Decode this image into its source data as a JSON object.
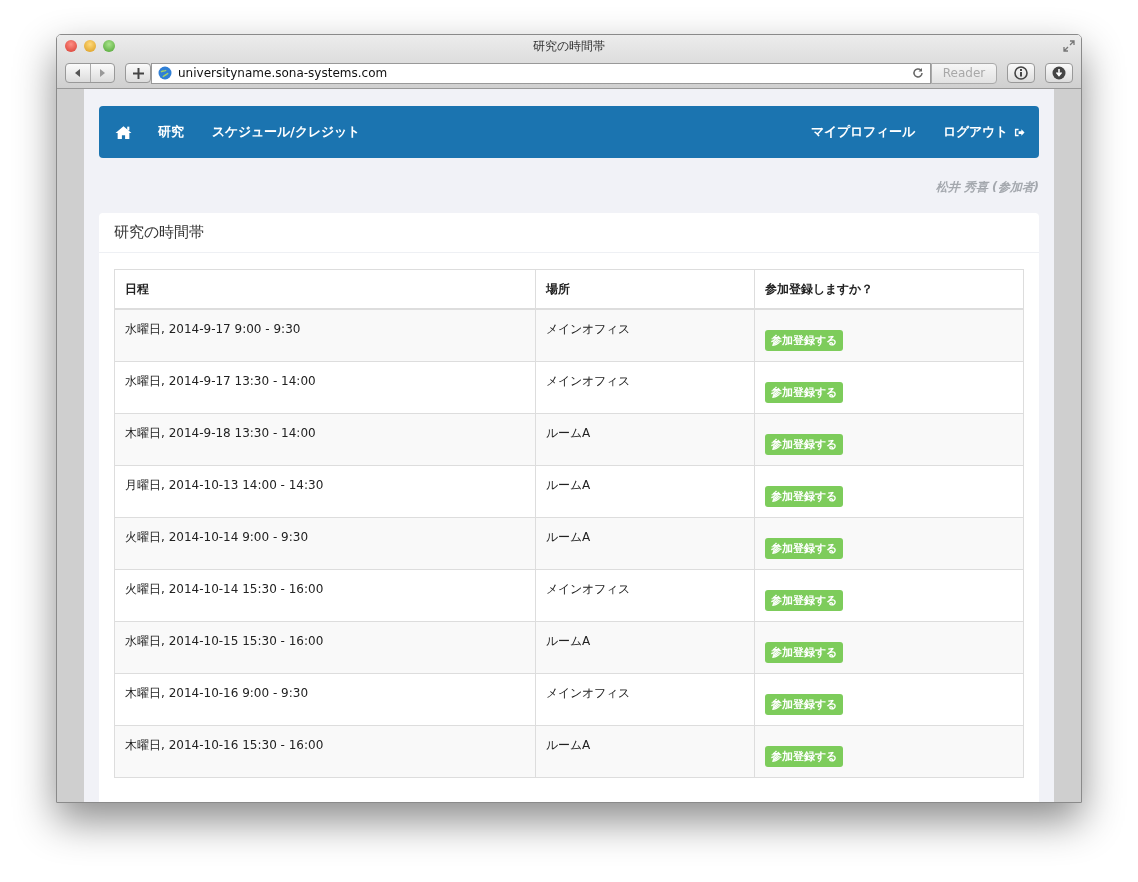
{
  "window": {
    "title": "研究の時間帯",
    "url": "universityname.sona-systems.com",
    "reader_button": "Reader"
  },
  "nav": {
    "items": [
      "研究",
      "スケジュール/クレジット"
    ],
    "right_items": [
      "マイプロフィール",
      "ログアウト"
    ]
  },
  "user": "松井 秀喜 (参加者)",
  "panel": {
    "title": "研究の時間帯"
  },
  "table": {
    "columns": [
      "日程",
      "場所",
      "参加登録しますか？"
    ],
    "rows": [
      {
        "date": "水曜日, 2014-9-17 9:00 - 9:30",
        "location": "メインオフィス",
        "action": "参加登録する"
      },
      {
        "date": "水曜日, 2014-9-17 13:30 - 14:00",
        "location": "メインオフィス",
        "action": "参加登録する"
      },
      {
        "date": "木曜日, 2014-9-18 13:30 - 14:00",
        "location": "ルームA",
        "action": "参加登録する"
      },
      {
        "date": "月曜日, 2014-10-13 14:00 - 14:30",
        "location": "ルームA",
        "action": "参加登録する"
      },
      {
        "date": "火曜日, 2014-10-14 9:00 - 9:30",
        "location": "ルームA",
        "action": "参加登録する"
      },
      {
        "date": "火曜日, 2014-10-14 15:30 - 16:00",
        "location": "メインオフィス",
        "action": "参加登録する"
      },
      {
        "date": "水曜日, 2014-10-15 15:30 - 16:00",
        "location": "ルームA",
        "action": "参加登録する"
      },
      {
        "date": "木曜日, 2014-10-16 9:00 - 9:30",
        "location": "メインオフィス",
        "action": "参加登録する"
      },
      {
        "date": "木曜日, 2014-10-16 15:30 - 16:00",
        "location": "ルームA",
        "action": "参加登録する"
      }
    ]
  }
}
